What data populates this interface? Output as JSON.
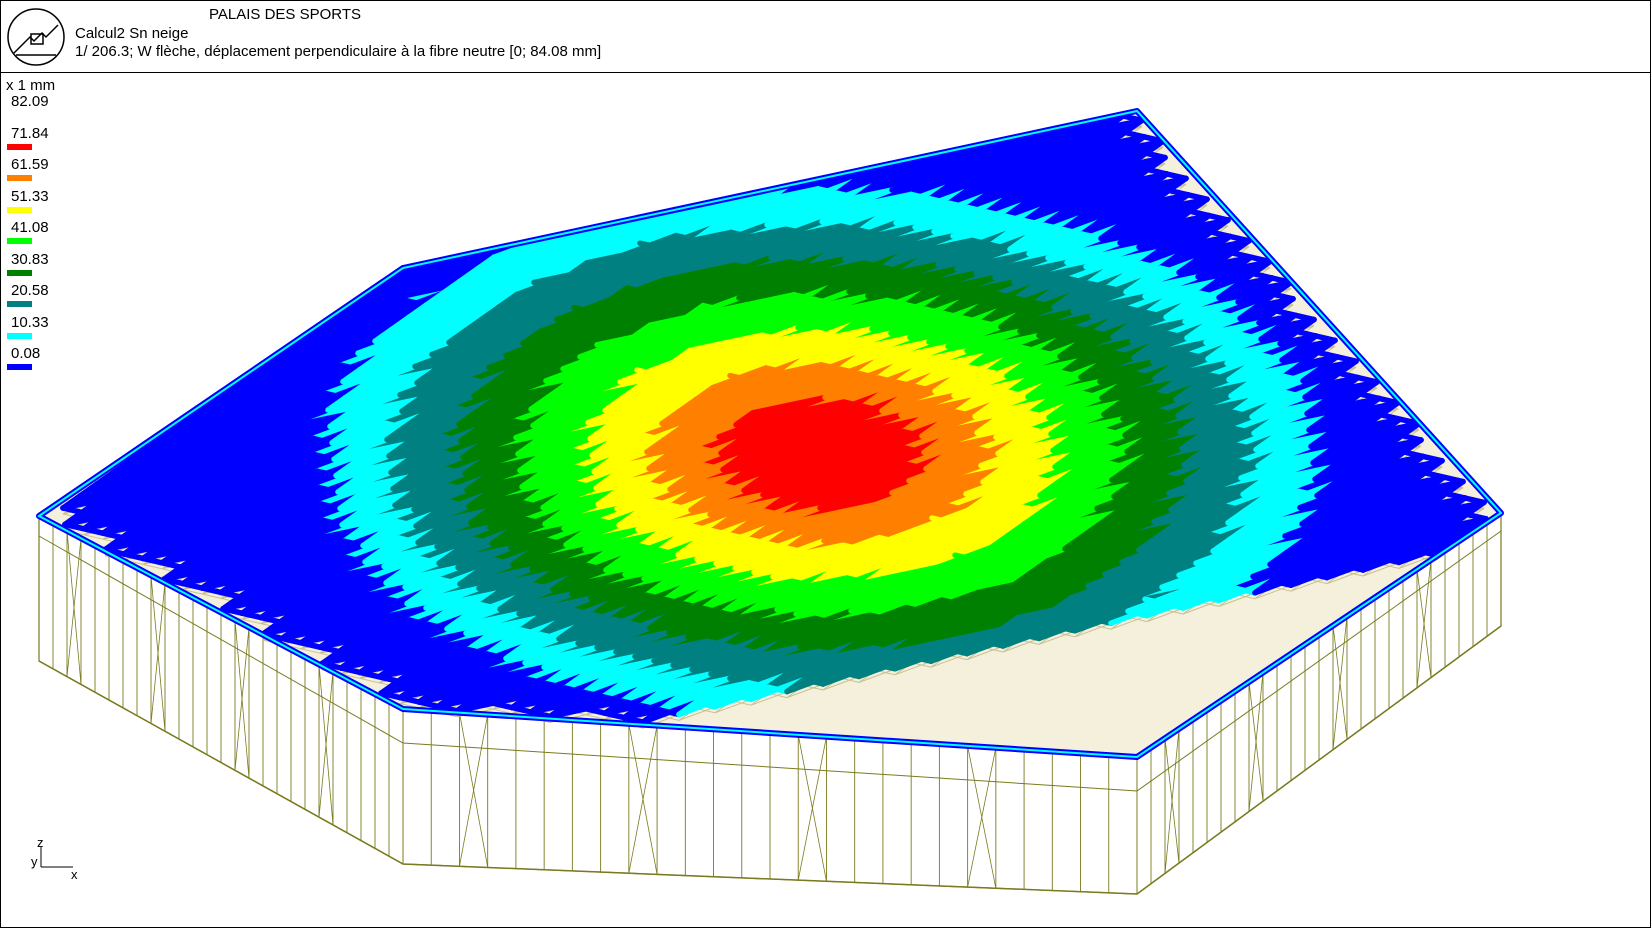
{
  "header": {
    "project_title": "PALAIS DES SPORTS",
    "load_case": "Calcul2 Sn neige",
    "result_description": "1/ 206.3; W  flèche, déplacement perpendiculaire à la fibre neutre [0; 84.08 mm]"
  },
  "legend": {
    "unit": "x 1 mm",
    "levels": [
      {
        "value": "82.09",
        "color": ""
      },
      {
        "value": "71.84",
        "color": "#ff0000"
      },
      {
        "value": "61.59",
        "color": "#ff8000"
      },
      {
        "value": "51.33",
        "color": "#ffff00"
      },
      {
        "value": "41.08",
        "color": "#00ff00"
      },
      {
        "value": "30.83",
        "color": "#008000"
      },
      {
        "value": "20.58",
        "color": "#008080"
      },
      {
        "value": "10.33",
        "color": "#00ffff"
      },
      {
        "value": "0.08",
        "color": "#0000ff"
      }
    ]
  },
  "axes": {
    "z": "z",
    "y": "y",
    "x": "x"
  },
  "colors": {
    "structure": "#7a7a1e",
    "strut": "#c8c090"
  }
}
